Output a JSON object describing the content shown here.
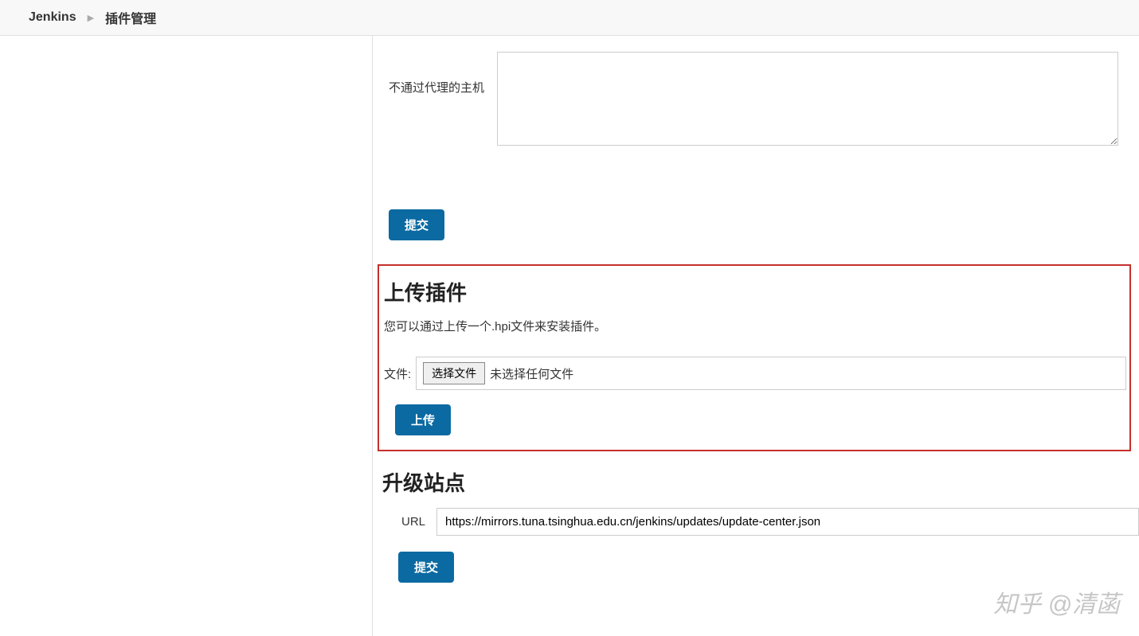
{
  "breadcrumb": {
    "root": "Jenkins",
    "current": "插件管理"
  },
  "proxy": {
    "no_proxy_label": "不通过代理的主机",
    "value": ""
  },
  "buttons": {
    "submit": "提交",
    "upload": "上传",
    "choose_file": "选择文件"
  },
  "upload_section": {
    "title": "上传插件",
    "desc": "您可以通过上传一个.hpi文件来安装插件。",
    "file_label": "文件:",
    "file_status": "未选择任何文件"
  },
  "upgrade_section": {
    "title": "升级站点",
    "url_label": "URL",
    "url_value": "https://mirrors.tuna.tsinghua.edu.cn/jenkins/updates/update-center.json"
  },
  "watermark": "知乎 @清菡"
}
